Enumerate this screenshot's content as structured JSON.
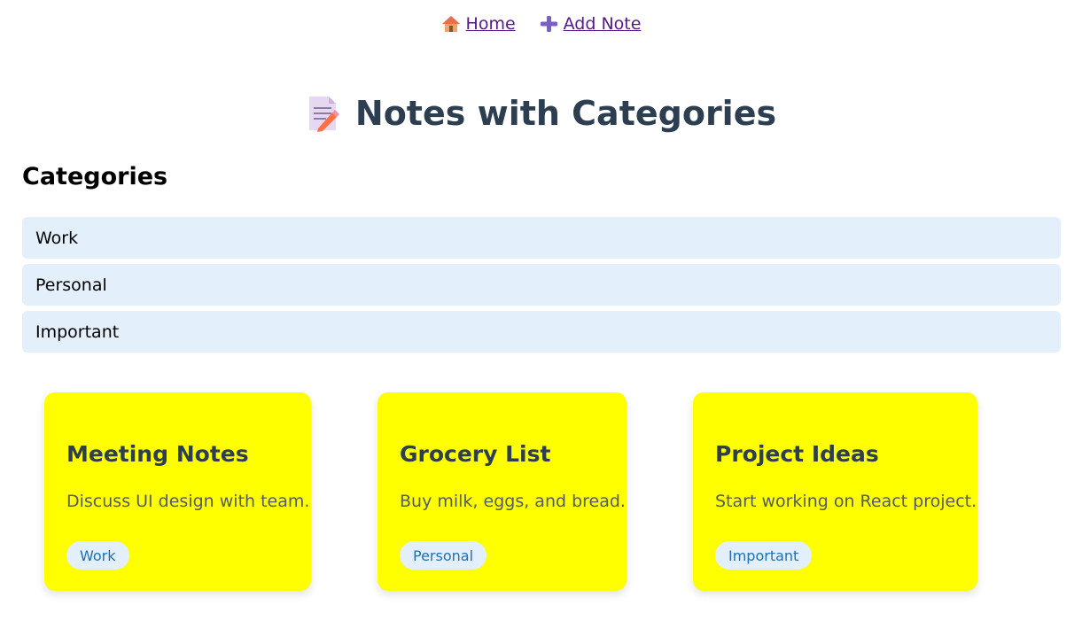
{
  "nav": {
    "home_label": "Home",
    "add_note_label": "Add Note",
    "home_icon": "house-icon",
    "add_icon": "plus-icon"
  },
  "page_title": "Notes with Categories",
  "title_icon": "memo-icon",
  "categories_heading": "Categories",
  "categories": [
    {
      "label": "Work"
    },
    {
      "label": "Personal"
    },
    {
      "label": "Important"
    }
  ],
  "notes": [
    {
      "title": "Meeting Notes",
      "content": "Discuss UI design with team.",
      "category": "Work"
    },
    {
      "title": "Grocery List",
      "content": "Buy milk, eggs, and bread.",
      "category": "Personal"
    },
    {
      "title": "Project Ideas",
      "content": "Start working on React project.",
      "category": "Important"
    }
  ],
  "colors": {
    "note_background": "#ffff00",
    "category_background": "#e3f0fb",
    "title_color": "#2c3e50",
    "link_color": "#55198b",
    "badge_text": "#1f6fb2"
  }
}
